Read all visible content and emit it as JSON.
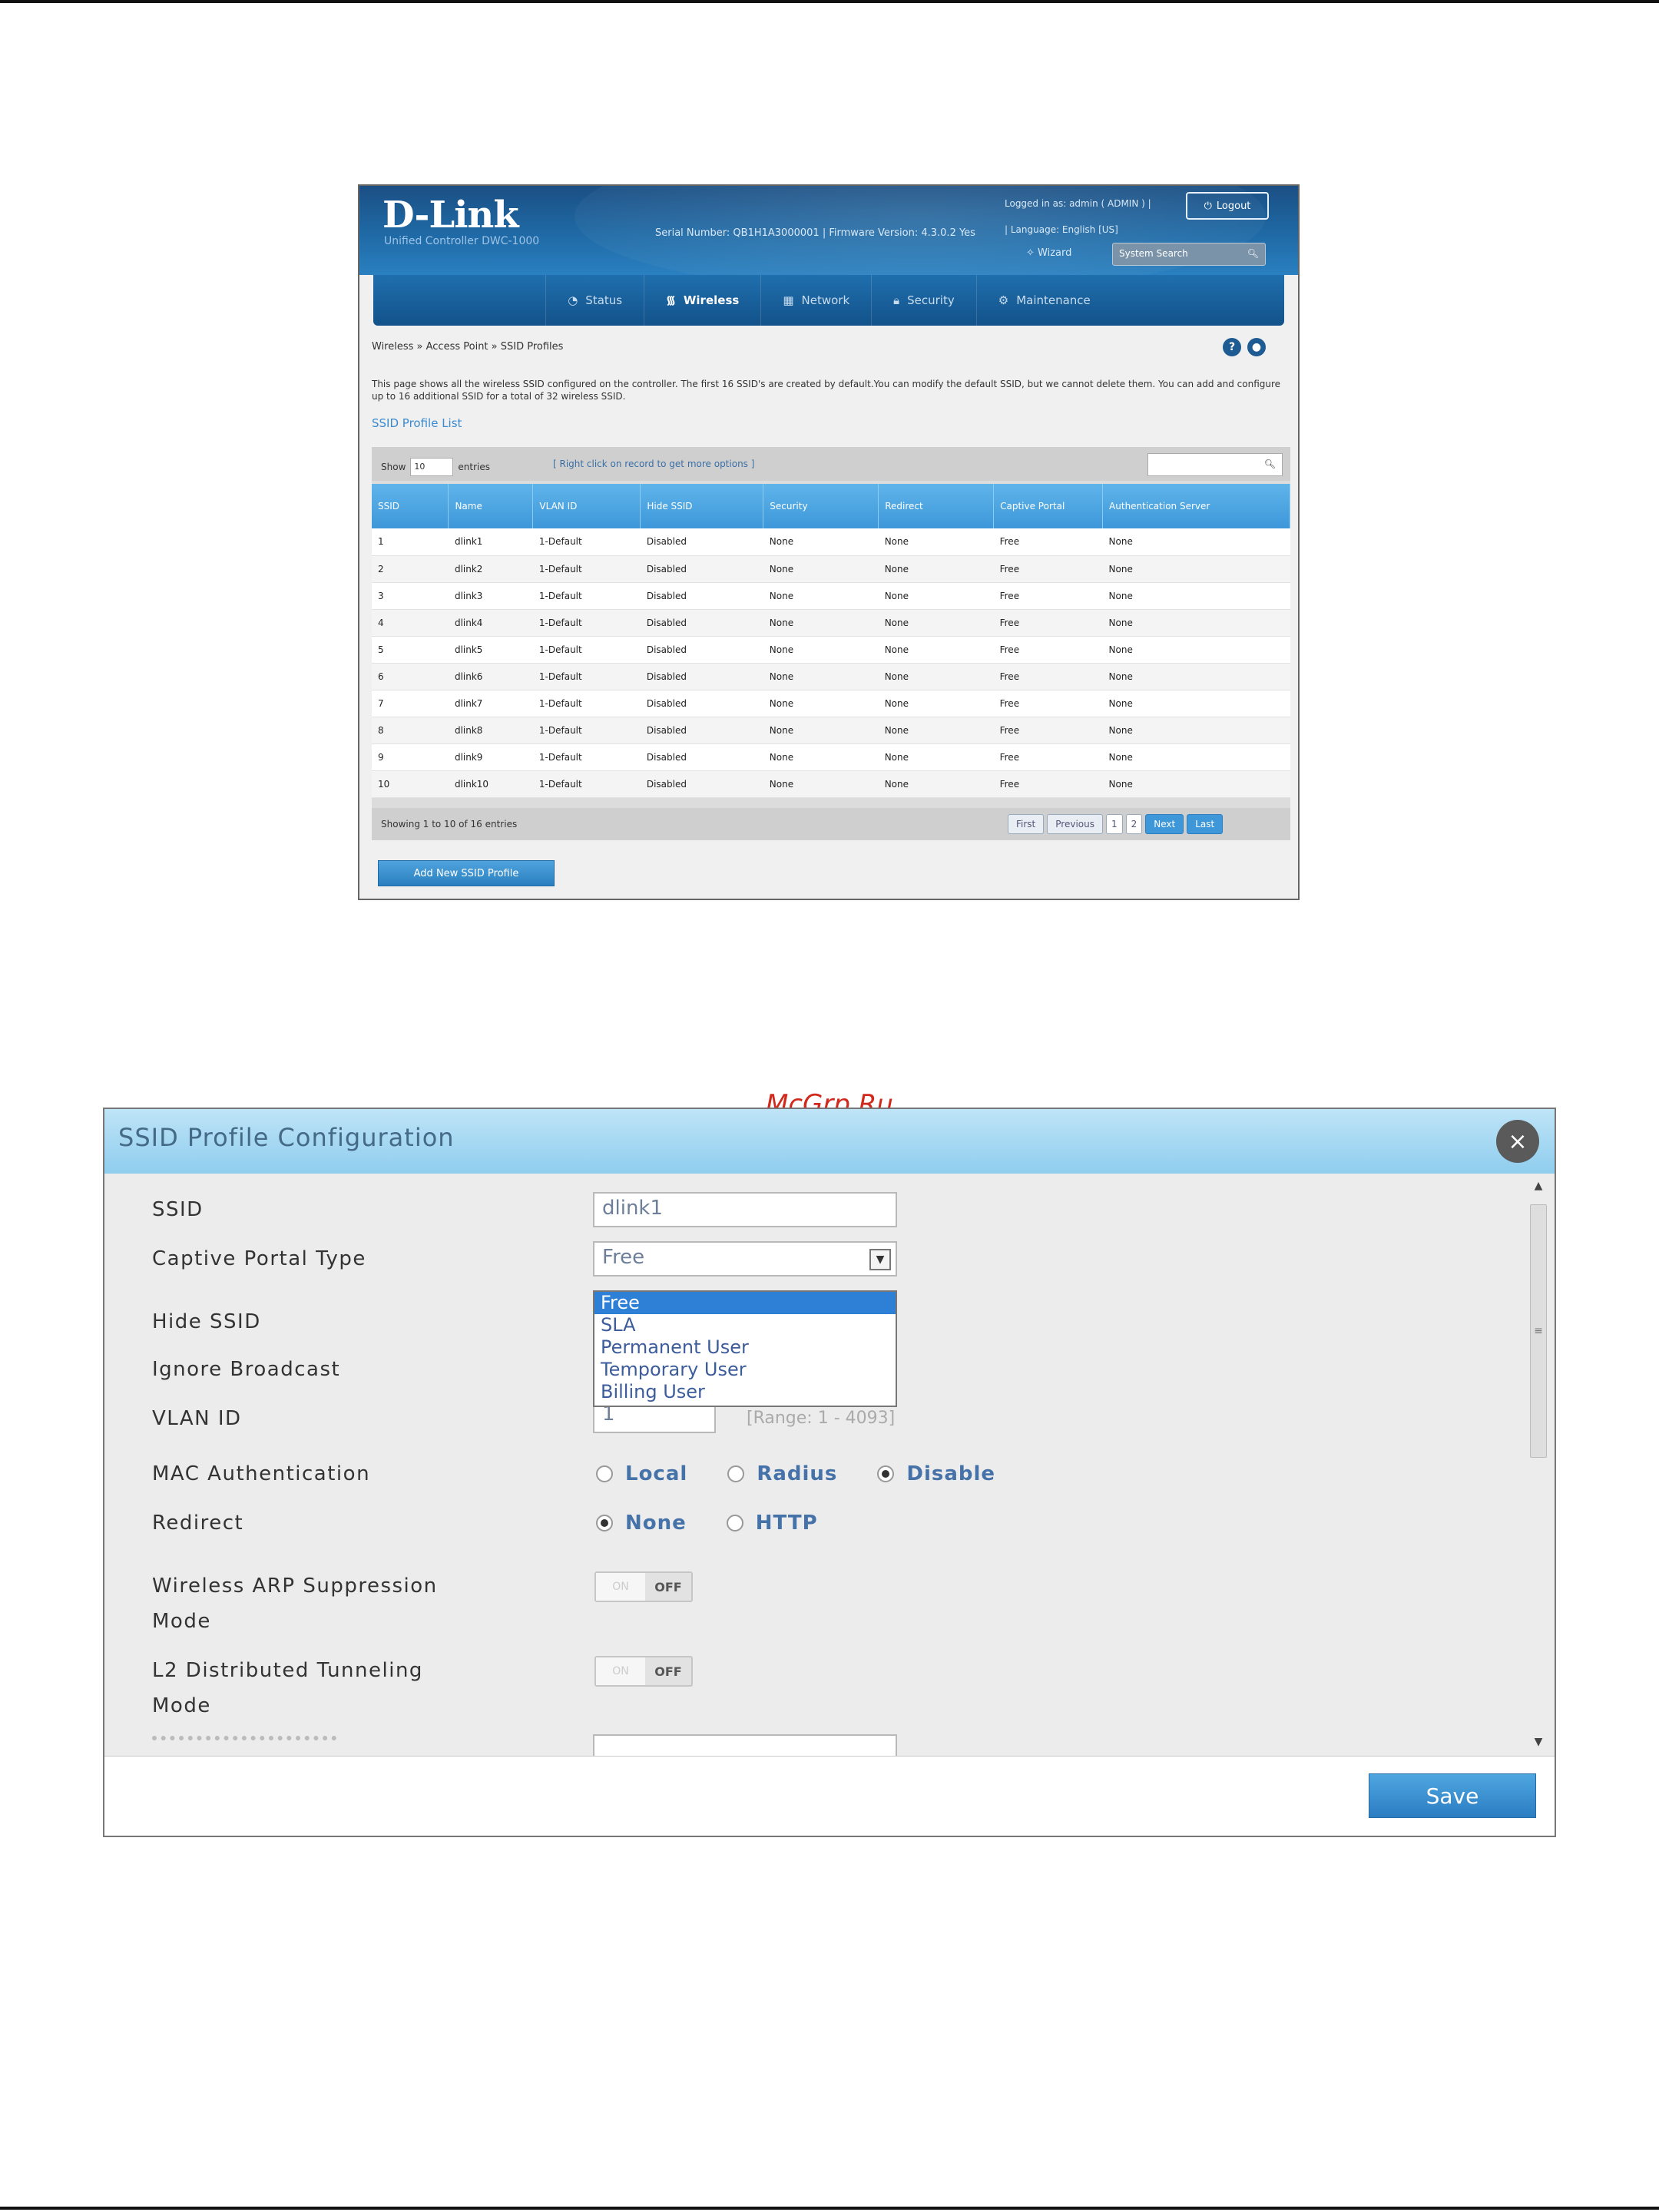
{
  "shot1": {
    "logo": "D-Link",
    "logo_sub": "Unified Controller   DWC-1000",
    "serial_text": "Serial Number: QB1H1A3000001 | Firmware Version: 4.3.0.2 Yes",
    "logged_in": "Logged in as: admin ( ADMIN ) |",
    "logout_label": "Logout",
    "language": "| Language: English [US]",
    "wizard_label": "Wizard",
    "system_search": "System Search",
    "nav": [
      {
        "label": "Status",
        "icon": "gauge-icon"
      },
      {
        "label": "Wireless",
        "icon": "wifi-icon"
      },
      {
        "label": "Network",
        "icon": "network-icon"
      },
      {
        "label": "Security",
        "icon": "lock-icon"
      },
      {
        "label": "Maintenance",
        "icon": "gear-icon"
      }
    ],
    "breadcrumb": "Wireless  »  Access Point  »  SSID Profiles",
    "description": "This page shows all the wireless SSID configured on the controller. The first 16 SSID's are created by default.You can modify the default SSID, but we cannot delete them. You can add and configure up to 16 additional SSID for a total of 32 wireless SSID.",
    "list_title": "SSID Profile List",
    "show_label": "Show",
    "show_value": "10",
    "entries_label": "entries",
    "hint": "[ Right click on record to get more options ]",
    "columns": [
      "SSID",
      "Name",
      "VLAN ID",
      "Hide SSID",
      "Security",
      "Redirect",
      "Captive Portal",
      "Authentication Server"
    ],
    "rows": [
      [
        "1",
        "dlink1",
        "1-Default",
        "Disabled",
        "None",
        "None",
        "Free",
        "None"
      ],
      [
        "2",
        "dlink2",
        "1-Default",
        "Disabled",
        "None",
        "None",
        "Free",
        "None"
      ],
      [
        "3",
        "dlink3",
        "1-Default",
        "Disabled",
        "None",
        "None",
        "Free",
        "None"
      ],
      [
        "4",
        "dlink4",
        "1-Default",
        "Disabled",
        "None",
        "None",
        "Free",
        "None"
      ],
      [
        "5",
        "dlink5",
        "1-Default",
        "Disabled",
        "None",
        "None",
        "Free",
        "None"
      ],
      [
        "6",
        "dlink6",
        "1-Default",
        "Disabled",
        "None",
        "None",
        "Free",
        "None"
      ],
      [
        "7",
        "dlink7",
        "1-Default",
        "Disabled",
        "None",
        "None",
        "Free",
        "None"
      ],
      [
        "8",
        "dlink8",
        "1-Default",
        "Disabled",
        "None",
        "None",
        "Free",
        "None"
      ],
      [
        "9",
        "dlink9",
        "1-Default",
        "Disabled",
        "None",
        "None",
        "Free",
        "None"
      ],
      [
        "10",
        "dlink10",
        "1-Default",
        "Disabled",
        "None",
        "None",
        "Free",
        "None"
      ]
    ],
    "footer_info": "Showing 1 to 10 of 16 entries",
    "pager": {
      "first": "First",
      "previous": "Previous",
      "page1": "1",
      "page2": "2",
      "next": "Next",
      "last": "Last"
    },
    "add_button": "Add New SSID Profile"
  },
  "watermark": "McGrp.Ru",
  "modal": {
    "title": "SSID Profile Configuration",
    "close_glyph": "×",
    "labels": {
      "ssid": "SSID",
      "captive_portal_type": "Captive Portal Type",
      "hide_ssid": "Hide SSID",
      "ignore_broadcast": "Ignore Broadcast",
      "vlan_id": "VLAN ID",
      "mac_auth": "MAC Authentication",
      "redirect": "Redirect",
      "arp_1": "Wireless ARP Suppression",
      "arp_2": "Mode",
      "l2_1": "L2 Distributed Tunneling",
      "l2_2": "Mode"
    },
    "ssid_value": "dlink1",
    "captive_portal_value": "Free",
    "captive_portal_options": [
      "Free",
      "SLA",
      "Permanent User",
      "Temporary User",
      "Billing User"
    ],
    "vlan_value": "1",
    "vlan_range": "[Range: 1 - 4093]",
    "mac_auth_options": [
      {
        "label": "Local",
        "selected": false
      },
      {
        "label": "Radius",
        "selected": false
      },
      {
        "label": "Disable",
        "selected": true
      }
    ],
    "redirect_options": [
      {
        "label": "None",
        "selected": true
      },
      {
        "label": "HTTP",
        "selected": false
      }
    ],
    "toggle_on": "ON",
    "toggle_off": "OFF",
    "save_label": "Save"
  }
}
